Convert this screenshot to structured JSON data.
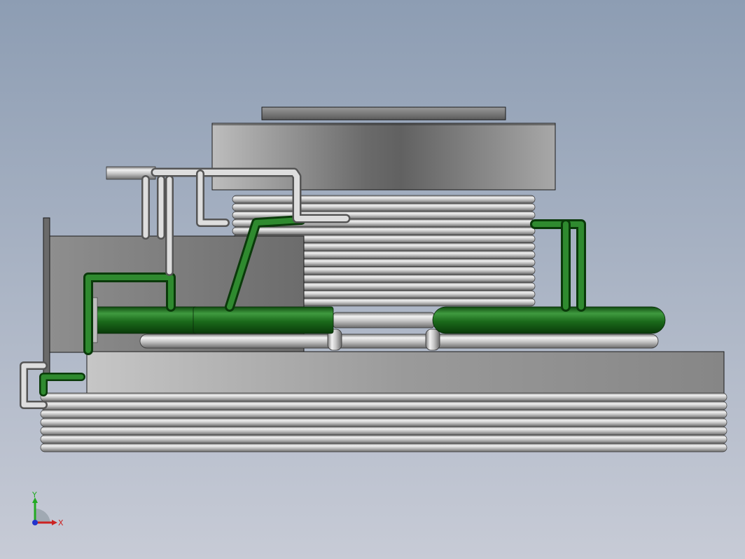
{
  "view": {
    "background_top": "#8d9db3",
    "background_bottom": "#c7cbd6"
  },
  "colors": {
    "pipe_gray_light": "#eeeeee",
    "pipe_gray_mid": "#b4b4b4",
    "pipe_gray_dark": "#6e6e6e",
    "pipe_green_light": "#3f9a3f",
    "pipe_green_mid": "#1b6a1b",
    "pipe_green_dark": "#0a3a0a",
    "housing_light": "#b8b8b8",
    "housing_dark": "#5f5f5f",
    "outline": "#1a1a1a"
  },
  "triad": {
    "x_label": "X",
    "y_label": "Y",
    "x_color": "#cc2222",
    "y_color": "#22aa22",
    "z_color": "#2233cc"
  },
  "model": {
    "top_coil_turns": 14,
    "bottom_coil_turns": 7,
    "icon": "3d-model-heat-exchanger"
  }
}
